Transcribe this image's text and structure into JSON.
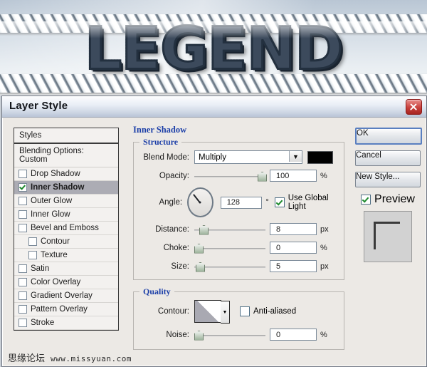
{
  "artwork": {
    "word": "LEGEND"
  },
  "watermark": {
    "site_cn": "思缘论坛",
    "url": "www.missyuan.com"
  },
  "dialog": {
    "title": "Layer Style",
    "close_icon": "close-icon"
  },
  "styles_panel": {
    "header": "Styles",
    "blending_options": "Blending Options: Custom",
    "effects": [
      {
        "label": "Drop Shadow",
        "checked": false,
        "indent": false,
        "selected": false
      },
      {
        "label": "Inner Shadow",
        "checked": true,
        "indent": false,
        "selected": true
      },
      {
        "label": "Outer Glow",
        "checked": false,
        "indent": false,
        "selected": false
      },
      {
        "label": "Inner Glow",
        "checked": false,
        "indent": false,
        "selected": false
      },
      {
        "label": "Bevel and Emboss",
        "checked": false,
        "indent": false,
        "selected": false
      },
      {
        "label": "Contour",
        "checked": false,
        "indent": true,
        "selected": false
      },
      {
        "label": "Texture",
        "checked": false,
        "indent": true,
        "selected": false
      },
      {
        "label": "Satin",
        "checked": false,
        "indent": false,
        "selected": false
      },
      {
        "label": "Color Overlay",
        "checked": false,
        "indent": false,
        "selected": false
      },
      {
        "label": "Gradient Overlay",
        "checked": false,
        "indent": false,
        "selected": false
      },
      {
        "label": "Pattern Overlay",
        "checked": false,
        "indent": false,
        "selected": false
      },
      {
        "label": "Stroke",
        "checked": false,
        "indent": false,
        "selected": false
      }
    ]
  },
  "panel": {
    "title": "Inner Shadow",
    "structure": {
      "legend": "Structure",
      "blend_mode_label": "Blend Mode:",
      "blend_mode_value": "Multiply",
      "blend_mode_color": "#000000",
      "opacity_label": "Opacity:",
      "opacity_value": "100",
      "opacity_unit": "%",
      "opacity_pct": 92,
      "angle_label": "Angle:",
      "angle_value": "128",
      "angle_unit": "°",
      "use_global_light_label": "Use Global Light",
      "use_global_light_checked": true,
      "distance_label": "Distance:",
      "distance_value": "8",
      "distance_unit": "px",
      "distance_pct": 7,
      "choke_label": "Choke:",
      "choke_value": "0",
      "choke_unit": "%",
      "choke_pct": 0,
      "size_label": "Size:",
      "size_value": "5",
      "size_unit": "px",
      "size_pct": 2
    },
    "quality": {
      "legend": "Quality",
      "contour_label": "Contour:",
      "anti_aliased_label": "Anti-aliased",
      "anti_aliased_checked": false,
      "noise_label": "Noise:",
      "noise_value": "0",
      "noise_unit": "%",
      "noise_pct": 0
    }
  },
  "buttons": {
    "ok": "OK",
    "cancel": "Cancel",
    "new_style": "New Style...",
    "preview_label": "Preview",
    "preview_checked": true
  }
}
